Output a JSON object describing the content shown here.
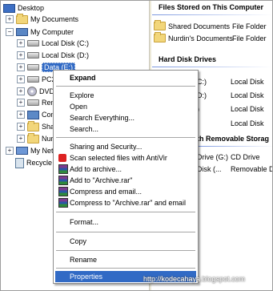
{
  "tree": {
    "items": [
      {
        "label": "Desktop",
        "icon": "desktop-icon",
        "expander": ""
      },
      {
        "label": "My Documents",
        "icon": "folder-icon",
        "expander": "+"
      },
      {
        "label": "My Computer",
        "icon": "computer-icon",
        "expander": "−"
      },
      {
        "label": "Local Disk (C:)",
        "icon": "drive-icon",
        "expander": "+"
      },
      {
        "label": "Local Disk (D:)",
        "icon": "drive-icon",
        "expander": "+"
      },
      {
        "label": "Data (E:)",
        "icon": "drive-icon",
        "expander": "+"
      },
      {
        "label": "PC22",
        "icon": "drive-icon",
        "expander": "+"
      },
      {
        "label": "DVD-",
        "icon": "disc-icon",
        "expander": "+"
      },
      {
        "label": "Remo",
        "icon": "drive-icon",
        "expander": "+"
      },
      {
        "label": "Contr",
        "icon": "control-panel-icon",
        "expander": "+"
      },
      {
        "label": "Share",
        "icon": "folder-icon",
        "expander": "+"
      },
      {
        "label": "Nurdi",
        "icon": "folder-icon",
        "expander": "+"
      },
      {
        "label": "My Netw",
        "icon": "network-icon",
        "expander": "+"
      },
      {
        "label": "Recycle B",
        "icon": "recycle-bin-icon",
        "expander": ""
      }
    ]
  },
  "files_group": {
    "heading": "Files Stored on This Computer",
    "rows": [
      {
        "name": "Shared Documents",
        "type": "File Folder"
      },
      {
        "name": "Nurdin's Documents",
        "type": "File Folder"
      }
    ]
  },
  "hdd_group": {
    "heading": "Hard Disk Drives",
    "rows": [
      {
        "name": "C:)",
        "type": "Local Disk"
      },
      {
        "name": "D:)",
        "type": "Local Disk"
      },
      {
        "name": ")",
        "type": "Local Disk"
      },
      {
        "name": "",
        "type": "Local Disk"
      }
    ]
  },
  "removable_group": {
    "heading": "th Removable Storag",
    "rows": [
      {
        "name": "Drive (G:)",
        "type": "CD Drive"
      },
      {
        "name": "Disk (...",
        "type": "Removable D"
      }
    ]
  },
  "context_menu": {
    "expand": "Expand",
    "explore": "Explore",
    "open": "Open",
    "search_everything": "Search Everything...",
    "search": "Search...",
    "sharing": "Sharing and Security...",
    "scan": "Scan selected files with AntiVir",
    "add_archive": "Add to archive...",
    "add_rar": "Add to \"Archive.rar\"",
    "compress_email": "Compress and email...",
    "compress_rar_email": "Compress to \"Archive.rar\" and email",
    "format": "Format...",
    "copy": "Copy",
    "rename": "Rename",
    "properties": "Properties"
  },
  "watermark": "http://kodecahaya.blogspot.com",
  "colors": {
    "selection": "#316ac5",
    "group_line": "#7a96df"
  }
}
